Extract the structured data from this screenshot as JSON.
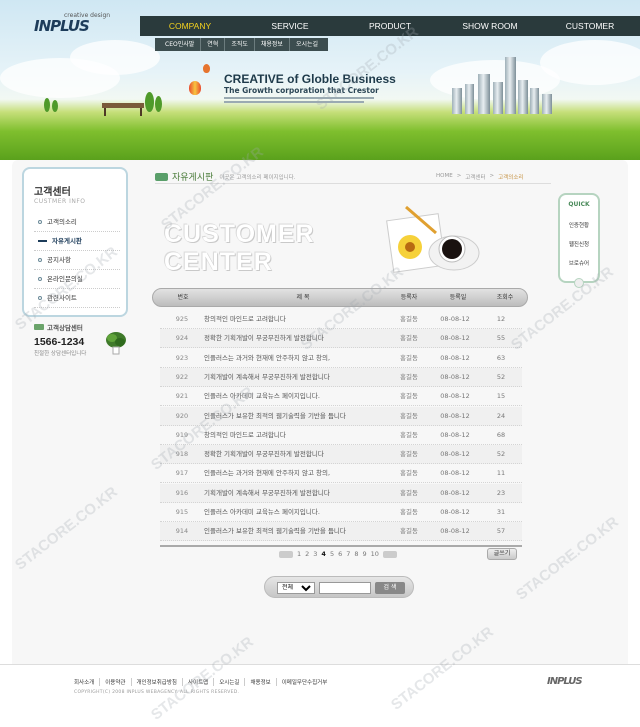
{
  "header": {
    "logo_sub": "creative design",
    "logo_main": "INPLUS",
    "nav": [
      "COMPANY",
      "SERVICE",
      "PRODUCT",
      "SHOW ROOM",
      "CUSTOMER"
    ],
    "active_nav": "COMPANY",
    "subnav": [
      "CEO인사말",
      "연혁",
      "조직도",
      "채용정보",
      "오시는길"
    ],
    "banner_title": "CREATIVE of Globle Business",
    "banner_sub": "The Growth corporation that Crestor"
  },
  "sidebar": {
    "title": "고객센터",
    "title_eng": "CUSTMER INFO",
    "items": [
      {
        "label": "고객의소리",
        "active": false
      },
      {
        "label": "자유게시판",
        "active": true
      },
      {
        "label": "공지사항",
        "active": false
      },
      {
        "label": "온라인문의실",
        "active": false
      },
      {
        "label": "관련사이트",
        "active": false
      }
    ],
    "cs_label": "고객상담센터",
    "cs_number": "1566-1234",
    "cs_desc": "친절한 상담센터입니다"
  },
  "board": {
    "title": "자유게시판",
    "desc": "이곳은 고객의소리 페이지입니다.",
    "breadcrumb": [
      "HOME",
      ">",
      "고객센터",
      ">",
      "고객의소리"
    ],
    "big_title_1": "CUSTOMER",
    "big_title_2": "CENTER",
    "columns": [
      "번호",
      "제 목",
      "등록자",
      "등록일",
      "조회수"
    ],
    "rows": [
      {
        "num": "925",
        "subject": "창의적인 마인드로 고려합니다",
        "writer": "홍길동",
        "date": "08-08-12",
        "views": "12"
      },
      {
        "num": "924",
        "subject": "정확한 기획개발이 무궁무진하게 발전합니다",
        "writer": "홍길동",
        "date": "08-08-12",
        "views": "55"
      },
      {
        "num": "923",
        "subject": "인플러스는 과거와 현재에 안주하지 않고 창의,",
        "writer": "홍길동",
        "date": "08-08-12",
        "views": "63"
      },
      {
        "num": "922",
        "subject": "기획개발이 계속해서 무궁무진하게 발전합니다",
        "writer": "홍길동",
        "date": "08-08-12",
        "views": "52"
      },
      {
        "num": "921",
        "subject": "인플러스 아카데미 교육뉴스 페이지입니다.",
        "writer": "홍길동",
        "date": "08-08-12",
        "views": "15"
      },
      {
        "num": "920",
        "subject": "인플러스가 보유한 최적의 웹기술력을 기반을 둡니다",
        "writer": "홍길동",
        "date": "08-08-12",
        "views": "24"
      },
      {
        "num": "919",
        "subject": "창의적인 마인드로 고려합니다",
        "writer": "홍길동",
        "date": "08-08-12",
        "views": "68"
      },
      {
        "num": "918",
        "subject": "정확한 기획개발이 무궁무진하게 발전합니다",
        "writer": "홍길동",
        "date": "08-08-12",
        "views": "52"
      },
      {
        "num": "917",
        "subject": "인플러스는 과거와 현재에 안주하지 않고 창의,",
        "writer": "홍길동",
        "date": "08-08-12",
        "views": "11"
      },
      {
        "num": "916",
        "subject": "기획개발이 계속해서 무궁무진하게 발전합니다",
        "writer": "홍길동",
        "date": "08-08-12",
        "views": "23"
      },
      {
        "num": "915",
        "subject": "인플러스 아카데미 교육뉴스 페이지입니다.",
        "writer": "홍길동",
        "date": "08-08-12",
        "views": "31"
      },
      {
        "num": "914",
        "subject": "인플러스가 보유한 최적의 웹기술력을 기반을 둡니다",
        "writer": "홍길동",
        "date": "08-08-12",
        "views": "57"
      }
    ],
    "pages": [
      "1",
      "2",
      "3",
      "4",
      "5",
      "6",
      "7",
      "8",
      "9",
      "10"
    ],
    "current_page": "4",
    "write_label": "글쓰기",
    "search_select": "전체",
    "search_button": "검 색"
  },
  "quick": {
    "title": "QUICK",
    "items": [
      "인증현황",
      "웹진신청",
      "브로슈어"
    ]
  },
  "footer": {
    "links": [
      "회사소개",
      "이용약관",
      "개인정보취급방침",
      "사이트맵",
      "오시는길",
      "채용정보",
      "이메일무단수집거부"
    ],
    "copyright": "COPYRIGHT(C) 2008 INPLUS WEBAGENCY. ALL RIGHTS RESERVED.",
    "logo": "INPLUS"
  },
  "watermark": "STACORE.CO.KR",
  "colors": {
    "nav_bg": "#2a3a3c",
    "nav_active": "#f4d21e",
    "accent_green": "#4a7c3a",
    "breadcrumb_current": "#c69344"
  }
}
